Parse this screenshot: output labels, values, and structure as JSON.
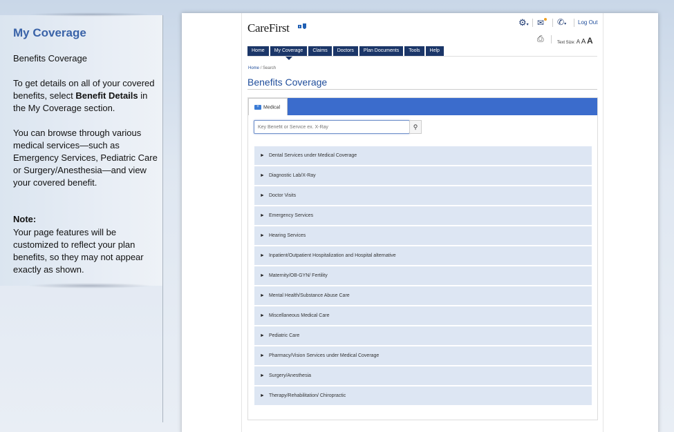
{
  "sidebar": {
    "title": "My Coverage",
    "subtitle": "Benefits Coverage",
    "para1_pre": "To get details on all of your covered benefits, select ",
    "para1_bold": "Benefit Details",
    "para1_post": " in the My Coverage section.",
    "para2": "You can browse through various medical services—such as Emergency Services, Pediatric Care or Surgery/Anesthesia—and view your covered benefit.",
    "note_label": "Note:",
    "note_text": "Your page features will be customized to reflect your plan benefits, so they may not appear exactly as shown."
  },
  "header": {
    "logo": "CareFirst",
    "logout": "Log Out",
    "text_size_label": "Text Size:",
    "text_size_options": [
      "A",
      "A",
      "A"
    ],
    "icons": [
      "gear-icon",
      "mail-icon",
      "phone-icon",
      "print-icon"
    ]
  },
  "nav": {
    "tabs": [
      "Home",
      "My Coverage",
      "Claims",
      "Doctors",
      "Plan Documents",
      "Tools",
      "Help"
    ],
    "active": "My Coverage"
  },
  "breadcrumb": {
    "home": "Home",
    "sep": "/",
    "current": "Search"
  },
  "page": {
    "title": "Benefits Coverage"
  },
  "tab": {
    "label": "Medical"
  },
  "search": {
    "placeholder": "Key Benefit or Service ex. X-Ray"
  },
  "items": [
    "Dental Services under Medical Coverage",
    "Diagnostic Lab/X-Ray",
    "Doctor Visits",
    "Emergency Services",
    "Hearing Services",
    "Inpatient/Outpatient Hospitalization and Hospital alternative",
    "Maternity/OB-GYN/ Fertility",
    "Mental Health/Substance Abuse Care",
    "Miscellaneous Medical Care",
    "Pediatric Care",
    "Pharmacy/Vision Services under Medical Coverage",
    "Surgery/Anesthesia",
    "Therapy/Rehabilitation/ Chiropractic"
  ],
  "colors": {
    "nav": "#1b3668",
    "accent": "#3b6ccc",
    "title": "#1f4d9b",
    "item_bg": "#dde6f3"
  }
}
